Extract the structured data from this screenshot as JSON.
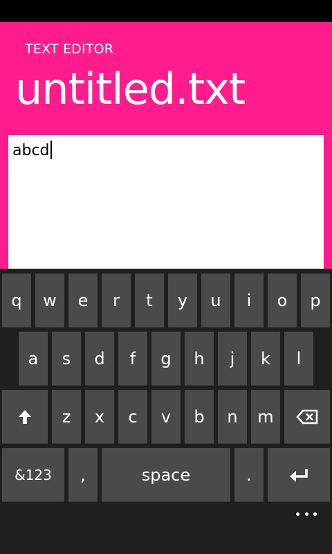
{
  "app": {
    "title": "TEXT EDITOR",
    "document_name": "untitled.txt"
  },
  "editor": {
    "text": "abcd"
  },
  "keyboard": {
    "row1": [
      "q",
      "w",
      "e",
      "r",
      "t",
      "y",
      "u",
      "i",
      "o",
      "p"
    ],
    "row2": [
      "a",
      "s",
      "d",
      "f",
      "g",
      "h",
      "j",
      "k",
      "l"
    ],
    "row3": [
      "z",
      "x",
      "c",
      "v",
      "b",
      "n",
      "m"
    ],
    "shift_icon": "shift-arrow-icon",
    "backspace_icon": "backspace-icon",
    "symbols_label": "&123",
    "comma_label": ",",
    "space_label": "space",
    "period_label": ".",
    "enter_icon": "enter-icon"
  },
  "app_bar": {
    "more_icon": "ellipsis-icon"
  },
  "colors": {
    "accent": "#ff1c8d",
    "key_background": "#4a4a4a",
    "keyboard_background": "#1f1f1f"
  }
}
